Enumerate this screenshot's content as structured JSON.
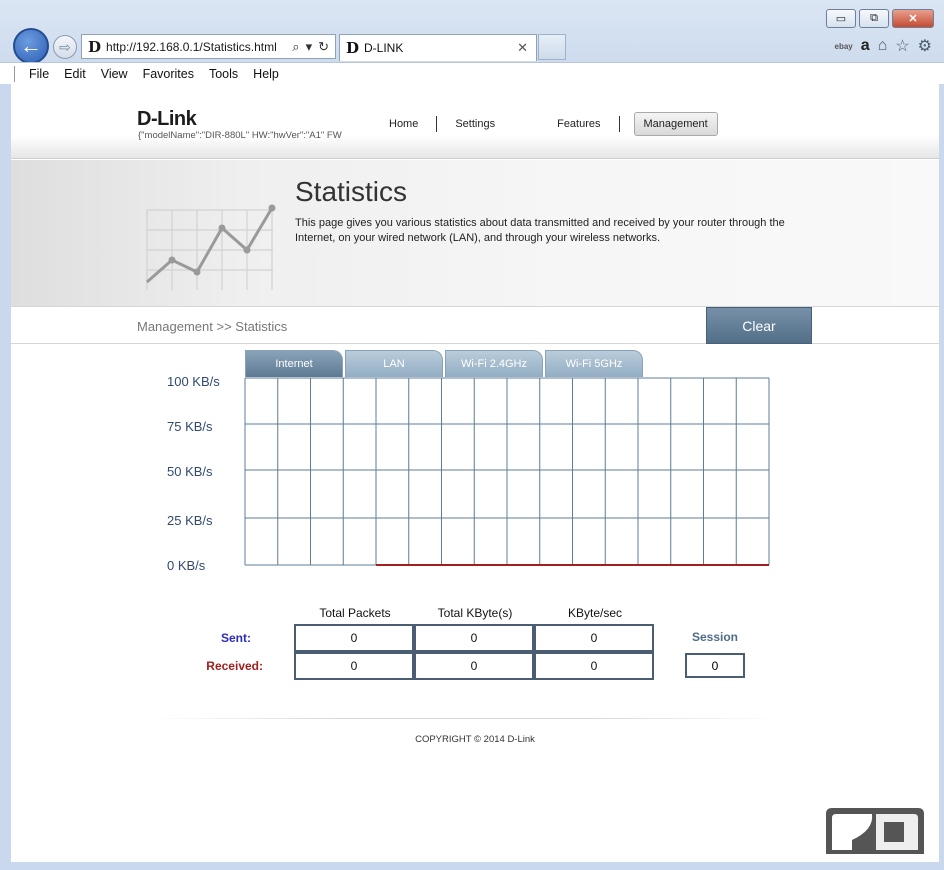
{
  "browser": {
    "url": "http://192.168.0.1/Statistics.html",
    "tab_title": "D-LINK",
    "favicon_letter": "D",
    "menu": [
      "File",
      "Edit",
      "View",
      "Favorites",
      "Tools",
      "Help"
    ],
    "window_buttons": {
      "minimize": "▭",
      "maximize": "⧉",
      "close": "✕"
    },
    "toolbar_icons": {
      "ebay": "ebay",
      "amazon": "a",
      "home": "⌂",
      "favorites": "☆",
      "settings": "⚙"
    }
  },
  "router": {
    "logo": "D-Link",
    "model_line": "{\"modelName\":\"DIR-880L\"   HW:\"hwVer\":\"A1\"   FW",
    "nav": [
      "Home",
      "Settings",
      "Features",
      "Management"
    ],
    "active_nav": "Management"
  },
  "banner": {
    "title": "Statistics",
    "description": "This page gives you various statistics about data transmitted and received by your router through the Internet, on your wired network (LAN), and through your wireless networks."
  },
  "breadcrumb": "Management >> Statistics",
  "clear_button": "Clear",
  "chart_tabs": [
    "Internet",
    "LAN",
    "Wi-Fi 2.4GHz",
    "Wi-Fi 5GHz"
  ],
  "active_chart_tab": "Internet",
  "chart_data": {
    "type": "line",
    "y_tick_labels": [
      "100 KB/s",
      "75 KB/s",
      "50 KB/s",
      "25 KB/s",
      "0 KB/s"
    ],
    "ylim": [
      0,
      100
    ],
    "grid": true,
    "series": [
      {
        "values": [
          0,
          0,
          0,
          0,
          0,
          0,
          0,
          0,
          0,
          0,
          0,
          0
        ],
        "color": "#a02020"
      }
    ]
  },
  "stats": {
    "columns": [
      "Total Packets",
      "Total KByte(s)",
      "KByte/sec"
    ],
    "sent_label": "Sent:",
    "received_label": "Received:",
    "sent": [
      "0",
      "0",
      "0"
    ],
    "received": [
      "0",
      "0",
      "0"
    ],
    "session_label": "Session",
    "session": "0"
  },
  "copyright": "COPYRIGHT © 2014 D-Link",
  "colors": {
    "accent": "#5d7a93",
    "sent": "#2b2bbf",
    "received": "#a02020"
  }
}
